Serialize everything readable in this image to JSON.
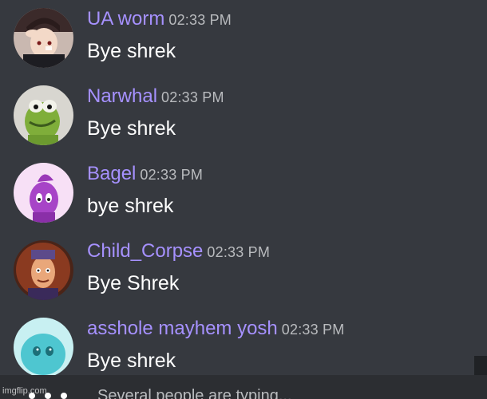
{
  "messages": [
    {
      "username": "UA worm",
      "time": "02:33 PM",
      "text": "Bye shrek",
      "avatar": "anime-boy-avatar"
    },
    {
      "username": "Narwhal",
      "time": "02:33 PM",
      "text": "Bye shrek",
      "avatar": "kermit-frog-avatar"
    },
    {
      "username": "Bagel",
      "time": "02:33 PM",
      "text": "bye shrek",
      "avatar": "purple-creature-avatar"
    },
    {
      "username": "Child_Corpse",
      "time": "02:33 PM",
      "text": "Bye Shrek",
      "avatar": "cartoon-man-avatar"
    },
    {
      "username": "asshole mayhem yosh",
      "time": "02:33 PM",
      "text": "Bye shrek",
      "avatar": "blue-blob-avatar"
    }
  ],
  "typing_indicator": {
    "text": "Several people are typing..."
  },
  "watermark": "imgflip.com",
  "colors": {
    "background": "#36393f",
    "username": "#a691ff",
    "timestamp": "#b9bbbe",
    "message_text": "#ffffff"
  }
}
